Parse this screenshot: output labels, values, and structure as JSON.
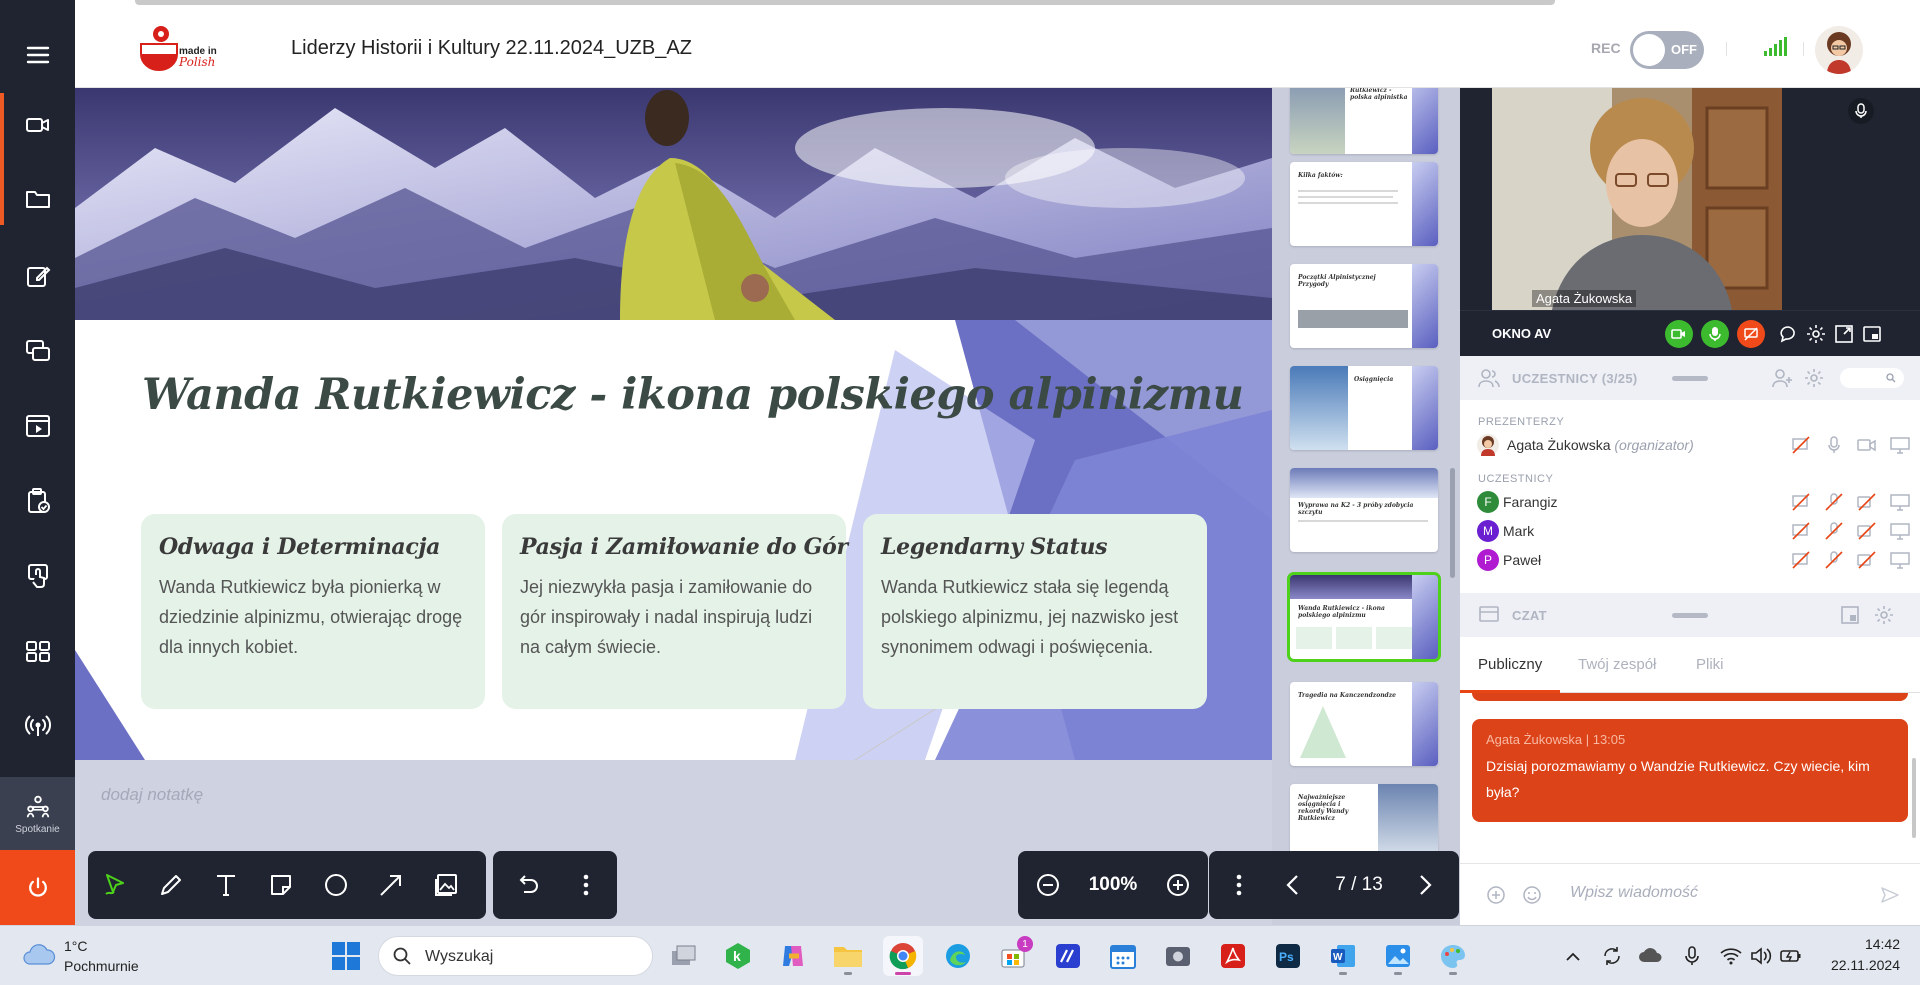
{
  "window": {
    "title": "Liderzy Historii i Kultury 22.11.2024_UZB_AZ",
    "logo_text": "made in Polish"
  },
  "recording": {
    "label": "REC",
    "state": "OFF"
  },
  "sidebar": {
    "items": [
      {
        "name": "video",
        "icon": "video-camera-icon"
      },
      {
        "name": "files",
        "icon": "folder-icon"
      },
      {
        "name": "whiteboard",
        "icon": "edit-icon"
      },
      {
        "name": "screen-share",
        "icon": "screens-icon"
      },
      {
        "name": "media",
        "icon": "film-icon"
      },
      {
        "name": "tests",
        "icon": "clipboard-check-icon"
      },
      {
        "name": "surveys",
        "icon": "hand-touch-icon"
      },
      {
        "name": "apps",
        "icon": "grid-icon"
      },
      {
        "name": "broadcast",
        "icon": "broadcast-icon"
      }
    ],
    "meeting_label": "Spotkanie"
  },
  "slide": {
    "title": "Wanda Rutkiewicz - ikona polskiego alpinizmu",
    "cards": [
      {
        "title": "Odwaga i Determinacja",
        "body": "Wanda Rutkiewicz była pionierką w dziedzinie alpinizmu, otwierając drogę dla innych kobiet."
      },
      {
        "title": "Pasja i Zamiłowanie do Gór",
        "body": "Jej niezwykła pasja i zamiłowanie do gór inspirowały i nadal inspirują ludzi na całym świecie."
      },
      {
        "title": "Legendarny Status",
        "body": "Wanda Rutkiewicz stała się legendą polskiego alpinizmu, jej nazwisko jest synonimem odwagi i poświęcenia."
      }
    ]
  },
  "notes": {
    "placeholder": "dodaj notatkę"
  },
  "thumbnails": [
    {
      "title": "Wanda Rutkiewicz - polska alpinistka"
    },
    {
      "title": "Kilka faktów:"
    },
    {
      "title": "Początki Alpinistycznej Przygody"
    },
    {
      "title": "Osiągnięcia"
    },
    {
      "title": "Wyprawa na K2 - 3 próby zdobycia szczytu"
    },
    {
      "title": "Wanda Rutkiewicz - ikona polskiego alpinizmu"
    },
    {
      "title": "Tragedia na Kanczendzondze"
    },
    {
      "title": "Najważniejsze osiągnięcia i rekordy Wandy Rutkiewicz"
    }
  ],
  "zoom": {
    "value": "100%"
  },
  "pagination": {
    "label": "7 / 13",
    "current": 7,
    "total": 13
  },
  "video": {
    "presenter_name": "Agata Żukowska",
    "panel_label": "OKNO AV"
  },
  "participants": {
    "title": "UCZESTNICY (3/25)",
    "presenters_label": "PREZENTERZY",
    "attendees_label": "UCZESTNICY",
    "presenter": {
      "name": "Agata Żukowska",
      "role": "(organizator)"
    },
    "attendees": [
      {
        "initial": "F",
        "name": "Farangiz",
        "color": "#2e8b3a"
      },
      {
        "initial": "M",
        "name": "Mark",
        "color": "#6a1fd0"
      },
      {
        "initial": "P",
        "name": "Paweł",
        "color": "#b01ad0"
      }
    ]
  },
  "chat": {
    "title": "CZAT",
    "tabs": [
      "Publiczny",
      "Twój zespół",
      "Pliki"
    ],
    "message": {
      "author": "Agata Żukowska",
      "time": "13:05",
      "text": "Dzisiaj porozmawiamy o Wandzie Rutkiewicz. Czy wiecie, kim była?"
    },
    "input_placeholder": "Wpisz wiadomość"
  },
  "taskbar": {
    "weather_temp": "1°C",
    "weather_desc": "Pochmurnie",
    "search_placeholder": "Wyszukaj",
    "time": "14:42",
    "date": "22.11.2024",
    "store_badge": "1"
  },
  "colors": {
    "accent": "#f04a1a",
    "sidebar_bg": "#1f2430",
    "card_bg": "#e4f2e8",
    "active_thumb": "#4ed11a",
    "chat_bubble": "#dc4318"
  }
}
